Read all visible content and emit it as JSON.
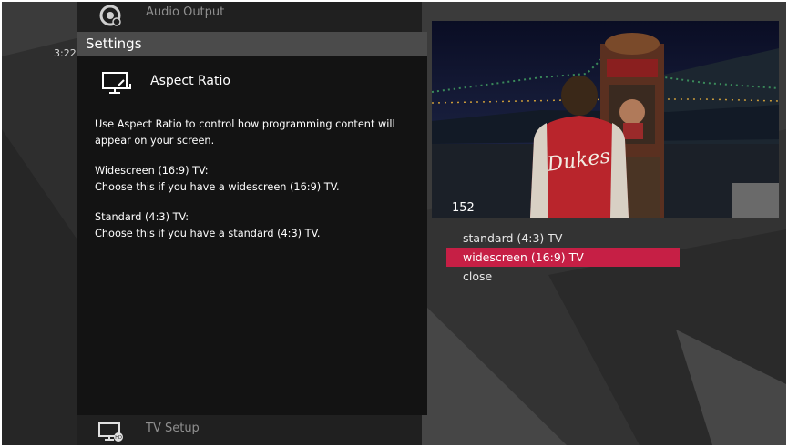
{
  "menu": {
    "top_item": {
      "label": "Audio Output",
      "icon": "speaker-icon"
    },
    "bottom_item": {
      "label": "TV Setup",
      "icon": "hd-tv-icon"
    }
  },
  "clock": {
    "time": "3:22"
  },
  "settings_panel": {
    "header": "Settings",
    "title": "Aspect Ratio",
    "title_icon": "aspect-ratio-icon",
    "intro": "Use Aspect Ratio to control how programming content will appear on your screen.",
    "widescreen_heading": "Widescreen (16:9) TV:",
    "widescreen_text": "Choose this if you have a widescreen (16:9) TV.",
    "standard_heading": "Standard (4:3) TV:",
    "standard_text": "Choose this if you have a standard (4:3) TV."
  },
  "video_preview": {
    "channel_number": "152",
    "jacket_text": "Dukes"
  },
  "options": [
    {
      "label": "standard (4:3) TV",
      "selected": false
    },
    {
      "label": "widescreen (16:9) TV",
      "selected": true
    },
    {
      "label": "close",
      "selected": false
    }
  ],
  "colors": {
    "highlight": "#c61f45",
    "panel_bg": "#131313",
    "header_bg": "#4b4b4b"
  }
}
